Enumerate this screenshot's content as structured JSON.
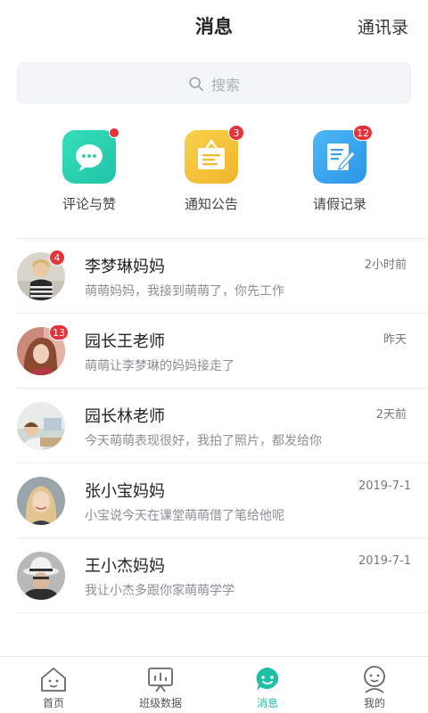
{
  "header": {
    "title": "消息",
    "contacts": "通讯录"
  },
  "search": {
    "placeholder": "搜索",
    "icon": "search-icon"
  },
  "quick_actions": [
    {
      "label": "评论与赞",
      "icon": "chat-bubble-icon",
      "color": "#2fd6b4",
      "badge": ""
    },
    {
      "label": "通知公告",
      "icon": "notice-board-icon",
      "color": "#f5c23c",
      "badge": "3"
    },
    {
      "label": "请假记录",
      "icon": "edit-note-icon",
      "color": "#3aa8f0",
      "badge": "12"
    }
  ],
  "messages": [
    {
      "name": "李梦琳妈妈",
      "preview": "萌萌妈妈，我接到萌萌了，你先工作",
      "time": "2小时前",
      "badge": "4"
    },
    {
      "name": "园长王老师",
      "preview": "萌萌让李梦琳的妈妈接走了",
      "time": "昨天",
      "badge": "13"
    },
    {
      "name": "园长林老师",
      "preview": "今天萌萌表现很好，我拍了照片，都发给你",
      "time": "2天前",
      "badge": ""
    },
    {
      "name": "张小宝妈妈",
      "preview": "小宝说今天在课堂萌萌借了笔给他呢",
      "time": "2019-7-1",
      "badge": ""
    },
    {
      "name": "王小杰妈妈",
      "preview": "我让小杰多跟你家萌萌学学",
      "time": "2019-7-1",
      "badge": ""
    }
  ],
  "tabs": [
    {
      "label": "首页",
      "icon": "home-icon",
      "active": false
    },
    {
      "label": "班级数据",
      "icon": "data-board-icon",
      "active": false
    },
    {
      "label": "消息",
      "icon": "message-icon",
      "active": true
    },
    {
      "label": "我的",
      "icon": "profile-icon",
      "active": false
    }
  ],
  "colors": {
    "accent": "#1fbfa6",
    "badge": "#e8323a"
  }
}
